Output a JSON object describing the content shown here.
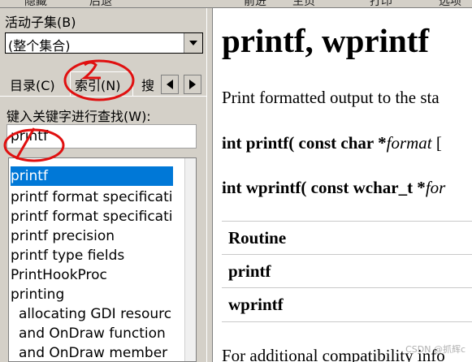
{
  "toolbar": {
    "items": [
      "隐藏",
      "后退",
      "前进",
      "主页",
      "打印",
      "选项"
    ]
  },
  "left": {
    "subset_label": "活动子集(B)",
    "subset_value": "(整个集合)",
    "tabs": {
      "contents": "目录(C)",
      "index": "索引(N)",
      "search": "搜"
    },
    "keyword_label": "键入关键字进行查找(W):",
    "keyword_value": "printf",
    "list_items": [
      "printf",
      "printf format specificati",
      "printf format specificati",
      "printf precision",
      "printf type fields",
      "PrintHookProc",
      "printing",
      "allocating GDI resourc",
      "and OnDraw function",
      "and OnDraw member"
    ]
  },
  "content": {
    "title": "printf, wprintf",
    "intro": "Print formatted output to the sta",
    "sig1_a": "int printf( const char *",
    "sig1_b": "format",
    "sig1_c": " [",
    "sig2_a": "int wprintf( const wchar_t *",
    "sig2_b": "for",
    "table_header": "Routine",
    "table_rows": [
      "printf",
      "wprintf"
    ],
    "footer": "For additional compatibility info"
  },
  "watermark": "CSDN @抓辉c",
  "colors": {
    "selection": "#0078d7",
    "annotation": "#e01010",
    "chrome": "#d4d0c8"
  }
}
